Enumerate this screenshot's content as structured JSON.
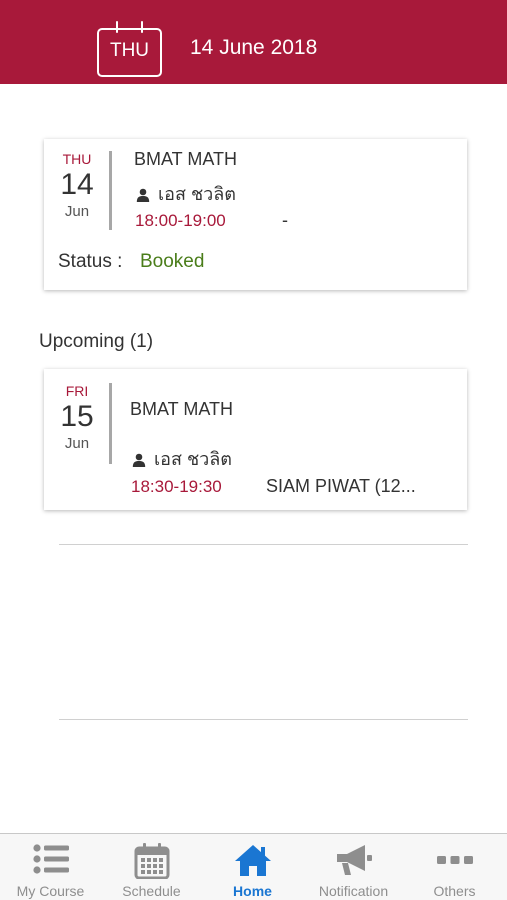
{
  "header": {
    "day_label": "THU",
    "date": "14 June 2018"
  },
  "today": {
    "dow": "THU",
    "day": "14",
    "month": "Jun",
    "course": "BMAT MATH",
    "teacher": "เอส ชวลิต",
    "time": "18:00-19:00",
    "location": "-",
    "status_label": "Status :",
    "status_value": "Booked",
    "status_color": "#4a7d1a"
  },
  "upcoming": {
    "heading": "Upcoming (1)",
    "items": [
      {
        "dow": "FRI",
        "day": "15",
        "month": "Jun",
        "course": "BMAT MATH",
        "teacher": "เอส ชวลิต",
        "time": "18:30-19:30",
        "location": "SIAM PIWAT (12..."
      }
    ]
  },
  "tabs": [
    {
      "label": "My Course",
      "icon": "list-icon",
      "active": false
    },
    {
      "label": "Schedule",
      "icon": "calendar-icon",
      "active": false
    },
    {
      "label": "Home",
      "icon": "home-icon",
      "active": true
    },
    {
      "label": "Notification",
      "icon": "megaphone-icon",
      "active": false
    },
    {
      "label": "Others",
      "icon": "more-dots-icon",
      "active": false
    }
  ],
  "colors": {
    "brand": "#a8193a",
    "active_tab": "#1a76d2",
    "inactive_tab": "#8e8e8e"
  }
}
